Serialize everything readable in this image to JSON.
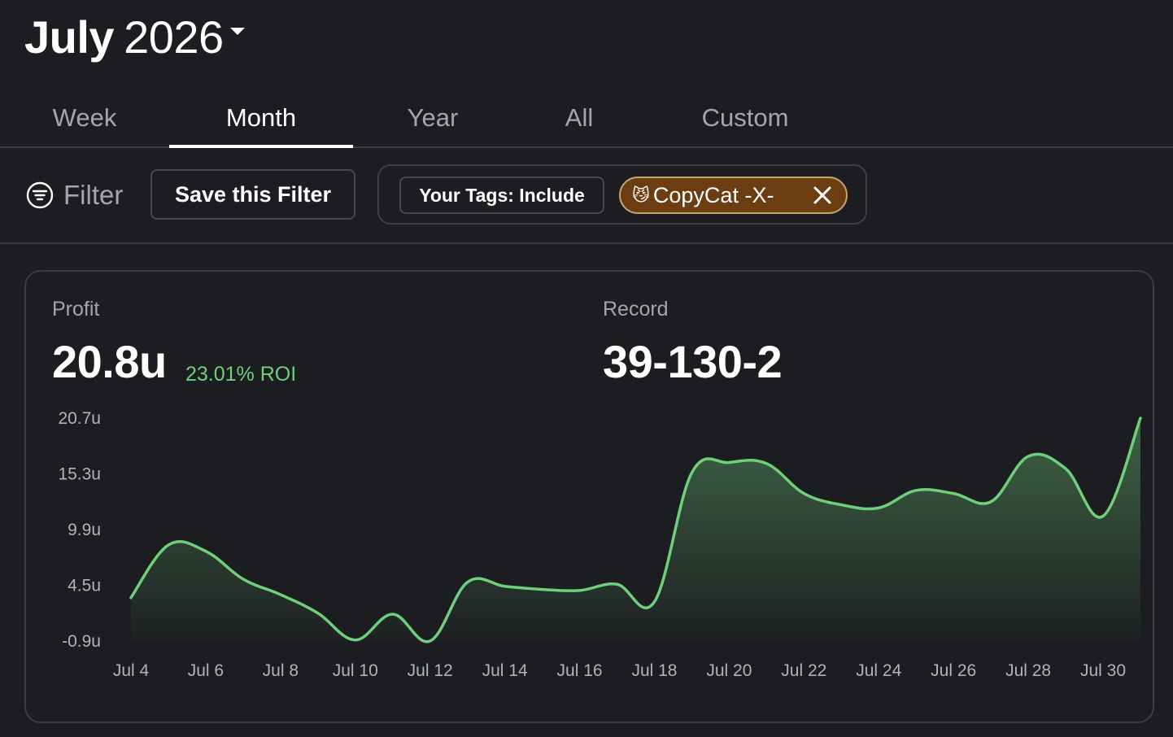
{
  "header": {
    "month": "July",
    "year": "2026"
  },
  "tabs": [
    {
      "label": "Week",
      "active": false
    },
    {
      "label": "Month",
      "active": true
    },
    {
      "label": "Year",
      "active": false
    },
    {
      "label": "All",
      "active": false
    },
    {
      "label": "Custom",
      "active": false
    }
  ],
  "filter": {
    "label": "Filter",
    "save_label": "Save this Filter",
    "tag_include_label": "Your Tags: Include",
    "tag_chip": {
      "emoji": "😼",
      "label": "CopyCat -X-",
      "color": "#6b3d10",
      "border_color": "#caa071"
    }
  },
  "stats": {
    "profit_label": "Profit",
    "profit_value": "20.8u",
    "roi": "23.01% ROI",
    "record_label": "Record",
    "record_value": "39-130-2"
  },
  "colors": {
    "background": "#1c1d21",
    "accent_green": "#6fcf7a",
    "muted_text": "#a3a6ad"
  },
  "chart_data": {
    "type": "area",
    "y_tick_labels": [
      "20.7u",
      "15.3u",
      "9.9u",
      "4.5u",
      "-0.9u"
    ],
    "y_ticks": [
      20.7,
      15.3,
      9.9,
      4.5,
      -0.9
    ],
    "ylim": [
      -0.9,
      20.7
    ],
    "x_tick_labels": [
      "Jul 4",
      "Jul 6",
      "Jul 8",
      "Jul 10",
      "Jul 12",
      "Jul 14",
      "Jul 16",
      "Jul 18",
      "Jul 20",
      "Jul 22",
      "Jul 24",
      "Jul 26",
      "Jul 28",
      "Jul 30"
    ],
    "x_ticks": [
      4,
      6,
      8,
      10,
      12,
      14,
      16,
      18,
      20,
      22,
      24,
      26,
      28,
      30
    ],
    "xlim": [
      4,
      31
    ],
    "x": [
      4,
      5,
      6,
      7,
      8,
      9,
      10,
      11,
      12,
      13,
      14,
      15,
      16,
      17,
      18,
      19,
      20,
      21,
      22,
      23,
      24,
      25,
      26,
      27,
      28,
      29,
      30,
      31
    ],
    "values": [
      3.3,
      8.4,
      7.8,
      5.1,
      3.6,
      1.8,
      -0.8,
      1.7,
      -0.9,
      4.8,
      4.4,
      4.1,
      4.0,
      4.6,
      2.9,
      15.4,
      16.4,
      16.3,
      13.4,
      12.3,
      12.0,
      13.7,
      13.4,
      12.6,
      17.0,
      15.8,
      11.2,
      20.7
    ],
    "grid": false,
    "legend": "none",
    "line_color": "#6fcf7a"
  }
}
